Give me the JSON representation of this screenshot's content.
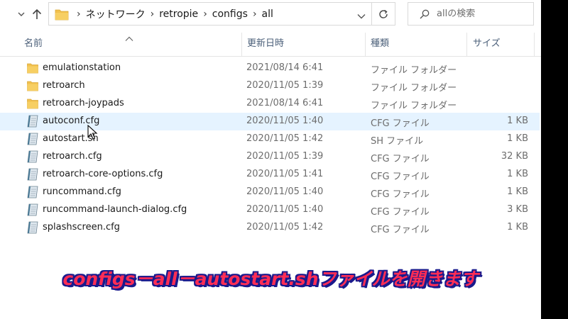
{
  "address": {
    "crumbs": [
      "ネットワーク",
      "retropie",
      "configs",
      "all"
    ]
  },
  "search": {
    "placeholder": "allの検索"
  },
  "columns": {
    "name": "名前",
    "date": "更新日時",
    "type": "種類",
    "size": "サイズ"
  },
  "files": [
    {
      "name": "emulationstation",
      "date": "2021/08/14 6:41",
      "type": "ファイル フォルダー",
      "size": "",
      "kind": "folder"
    },
    {
      "name": "retroarch",
      "date": "2020/11/05 1:39",
      "type": "ファイル フォルダー",
      "size": "",
      "kind": "folder"
    },
    {
      "name": "retroarch-joypads",
      "date": "2021/08/14 6:41",
      "type": "ファイル フォルダー",
      "size": "",
      "kind": "folder"
    },
    {
      "name": "autoconf.cfg",
      "date": "2020/11/05 1:40",
      "type": "CFG ファイル",
      "size": "1 KB",
      "kind": "file"
    },
    {
      "name": "autostart.sh",
      "date": "2020/11/05 1:42",
      "type": "SH ファイル",
      "size": "1 KB",
      "kind": "file"
    },
    {
      "name": "retroarch.cfg",
      "date": "2020/11/05 1:39",
      "type": "CFG ファイル",
      "size": "32 KB",
      "kind": "file"
    },
    {
      "name": "retroarch-core-options.cfg",
      "date": "2020/11/05 1:41",
      "type": "CFG ファイル",
      "size": "1 KB",
      "kind": "file"
    },
    {
      "name": "runcommand.cfg",
      "date": "2020/11/05 1:40",
      "type": "CFG ファイル",
      "size": "1 KB",
      "kind": "file"
    },
    {
      "name": "runcommand-launch-dialog.cfg",
      "date": "2020/11/05 1:40",
      "type": "CFG ファイル",
      "size": "3 KB",
      "kind": "file"
    },
    {
      "name": "splashscreen.cfg",
      "date": "2020/11/05 1:42",
      "type": "CFG ファイル",
      "size": "1 KB",
      "kind": "file"
    }
  ],
  "hovered_row": 3,
  "caption": "configs－all－autostart.shファイルを開きます",
  "colors": {
    "folder": "#f2c14e",
    "hover": "#e5f3ff",
    "caption_fill": "#ff2d55",
    "caption_outline": "#1a1a8c"
  }
}
